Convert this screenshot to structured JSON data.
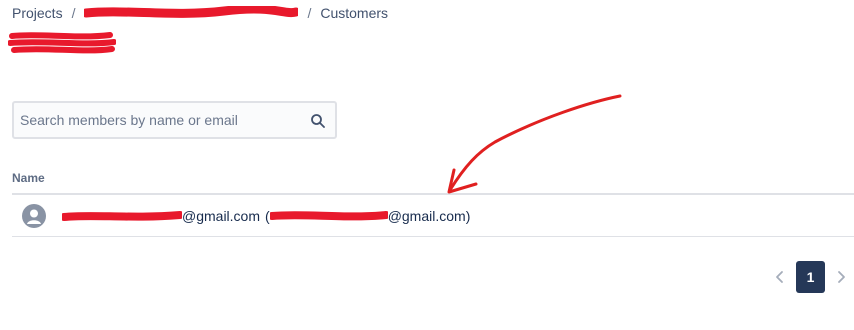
{
  "breadcrumb": {
    "items": [
      {
        "label": "Projects"
      },
      {
        "label": ""
      },
      {
        "label": "Customers"
      }
    ],
    "separator": "/"
  },
  "page_title": "",
  "search": {
    "placeholder": "Search members by name or email",
    "value": "",
    "icon": "search-icon"
  },
  "table": {
    "columns": [
      "Name"
    ],
    "rows": [
      {
        "avatar_icon": "user-avatar-icon",
        "email_suffix": "@gmail.com",
        "paren_open": "(",
        "paren_email_suffix": "@gmail.com)"
      }
    ]
  },
  "pagination": {
    "prev_icon": "chevron-left-icon",
    "current_page": "1",
    "next_icon": "chevron-right-icon"
  },
  "colors": {
    "redaction": "#e8192c",
    "annotation": "#e02020",
    "page_active": "#253858",
    "border": "#dfe1e6",
    "text": "#172b4d",
    "muted": "#6b778c"
  }
}
